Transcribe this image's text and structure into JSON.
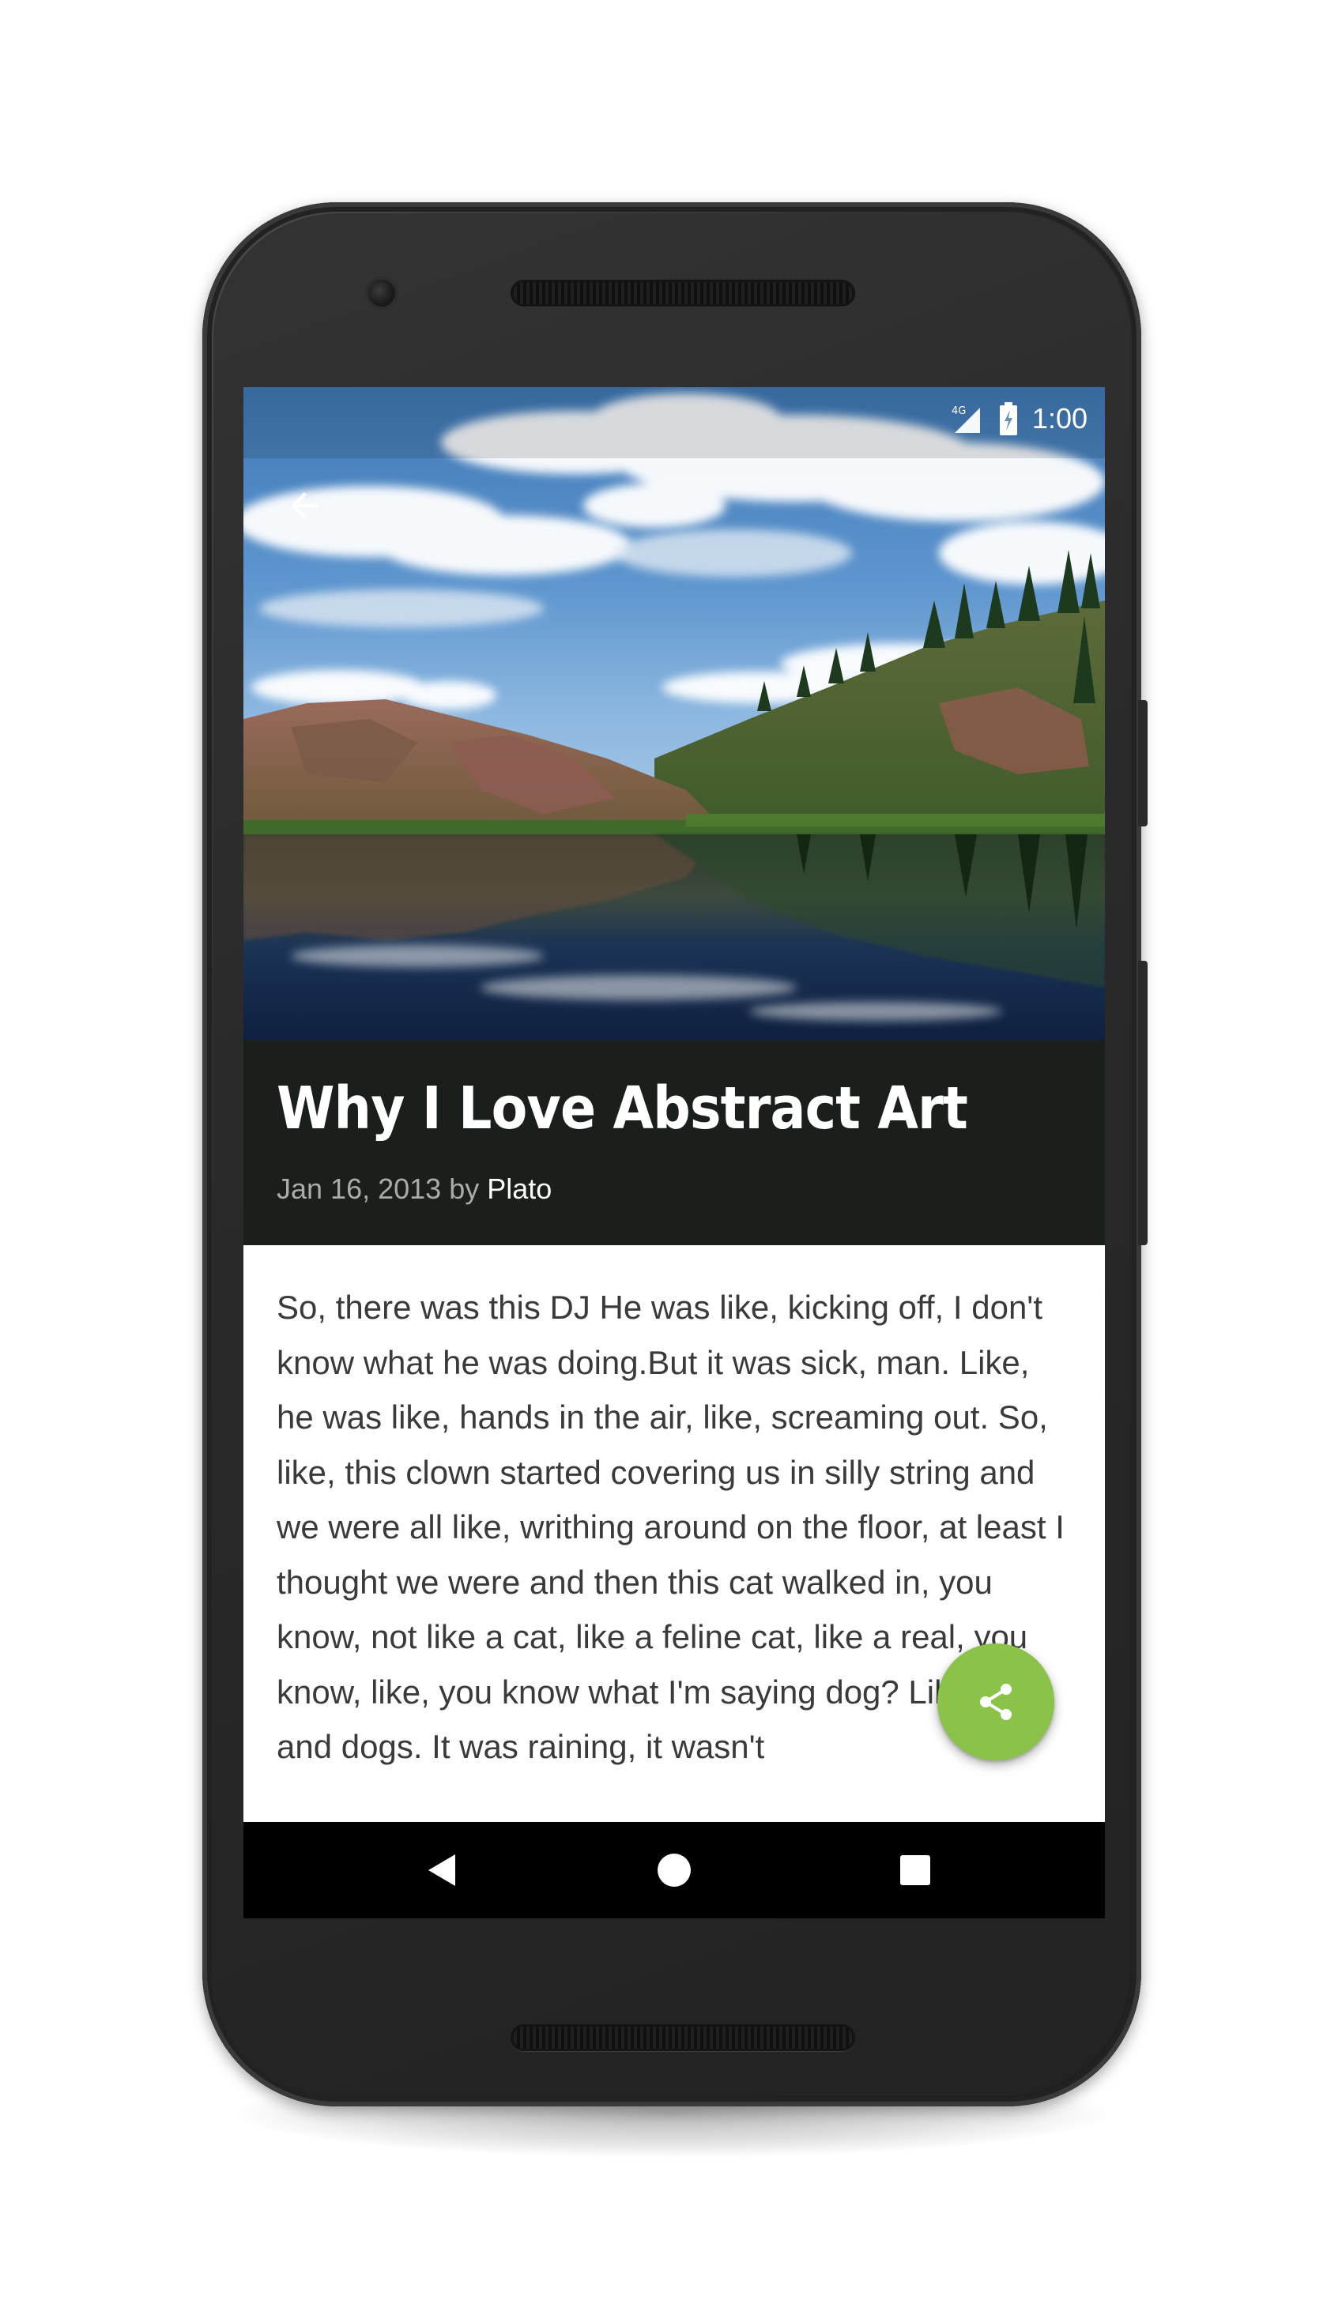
{
  "status_bar": {
    "network_label": "4G",
    "signal_icon": "cellular-signal-icon",
    "battery_icon": "battery-charging-icon",
    "time": "1:00"
  },
  "toolbar": {
    "back_icon": "arrow-back-icon"
  },
  "hero_image": {
    "subject": "mountain-lake-landscape"
  },
  "article": {
    "title": "Why I Love Abstract Art",
    "date": "Jan 16, 2013",
    "by": "by",
    "author": "Plato",
    "body": "So, there was this DJ He was like, kicking off, I don't know what he was doing.But it was sick, man. Like, he was like, hands in the air, like, screaming out. So, like, this clown started covering us in silly string and we were all like, writhing around on the floor, at least I thought we were and then this cat walked in, you know, not like a cat, like a feline cat, like a real, you know, like, you know what I'm saying dog? Like cats and dogs. It was raining, it wasn't"
  },
  "fab": {
    "icon": "share-icon",
    "color": "#8bc34a"
  },
  "navigation_bar": {
    "back_icon": "nav-back-icon",
    "home_icon": "nav-home-icon",
    "recents_icon": "nav-recents-icon"
  },
  "colors": {
    "title_block_bg": "#1b1f1b",
    "body_text": "#3a3a3a",
    "byline_muted": "#a9aca9",
    "accent": "#8bc34a"
  }
}
